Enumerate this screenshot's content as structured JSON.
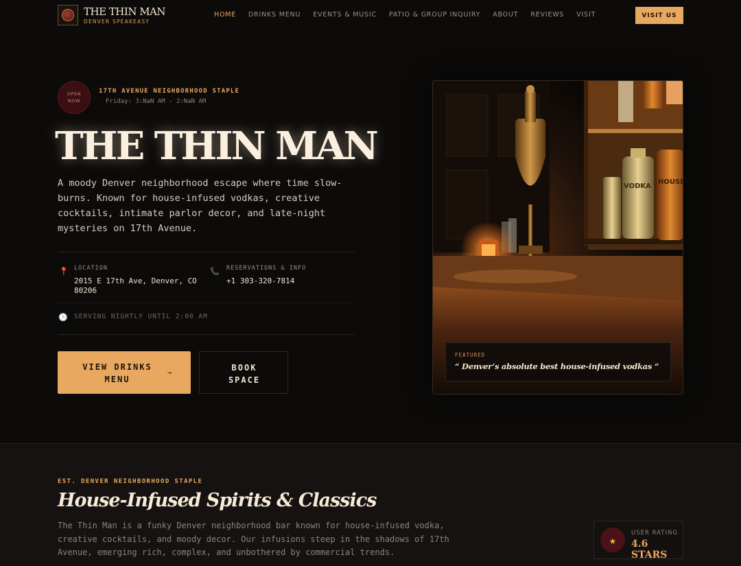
{
  "brand": {
    "name": "THE THIN MAN",
    "subtitle": "DENVER SPEAKEASY"
  },
  "nav": {
    "links": [
      {
        "label": "HOME"
      },
      {
        "label": "DRINKS MENU"
      },
      {
        "label": "EVENTS & MUSIC"
      },
      {
        "label": "PATIO & GROUP INQUIRY"
      },
      {
        "label": "ABOUT"
      },
      {
        "label": "REVIEWS"
      },
      {
        "label": "VISIT"
      }
    ],
    "cta": "VISIT US"
  },
  "hero": {
    "badge_line1": "OPEN",
    "badge_line2": "NOW",
    "kicker": "17TH AVENUE NEIGHBORHOOD STAPLE",
    "hours": "Friday: 3:NaN AM - 2:NaN AM",
    "title": "THE THIN MAN",
    "description": "A moody Denver neighborhood escape where time slow-burns. Known for house-infused vodkas, creative cocktails, intimate parlor decor, and late-night mysteries on 17th Avenue.",
    "location_label": "LOCATION",
    "location_line1": "2015 E 17th Ave, Denver, CO",
    "location_line2": "80206",
    "reservations_label": "RESERVATIONS & INFO",
    "phone": "+1 303-320-7814",
    "serving": "SERVING NIGHTLY UNTIL 2:00 AM",
    "primary_line1": "VIEW DRINKS",
    "primary_line2": "MENU",
    "primary_arrow": "→",
    "secondary_line1": "BOOK",
    "secondary_line2": "SPACE"
  },
  "featured": {
    "label": "FEATURED",
    "quote": "“ Denver’s absolute best house-infused vodkas ”"
  },
  "bottle_labels": {
    "vodka": "VODKA",
    "house": "HOUSE"
  },
  "section": {
    "kicker": "EST. DENVER NEIGHBORHOOD STAPLE",
    "title": "House-Infused Spirits & Classics",
    "description": "The Thin Man is a funky Denver neighborhood bar known for house-infused vodka, creative cocktails, and moody decor. Our infusions steep in the shadows of 17th Avenue, emerging rich, complex, and unbothered by commercial trends."
  },
  "rating": {
    "label": "USER RATING",
    "value": "4.6 STARS"
  },
  "icons": {
    "location": "map-pin-icon",
    "phone": "phone-icon",
    "clock": "clock-icon",
    "star": "star-icon"
  },
  "colors": {
    "accent": "#e8a860",
    "background": "#0c0b0a",
    "badge": "#3a0e12",
    "section_bg": "#161211"
  }
}
